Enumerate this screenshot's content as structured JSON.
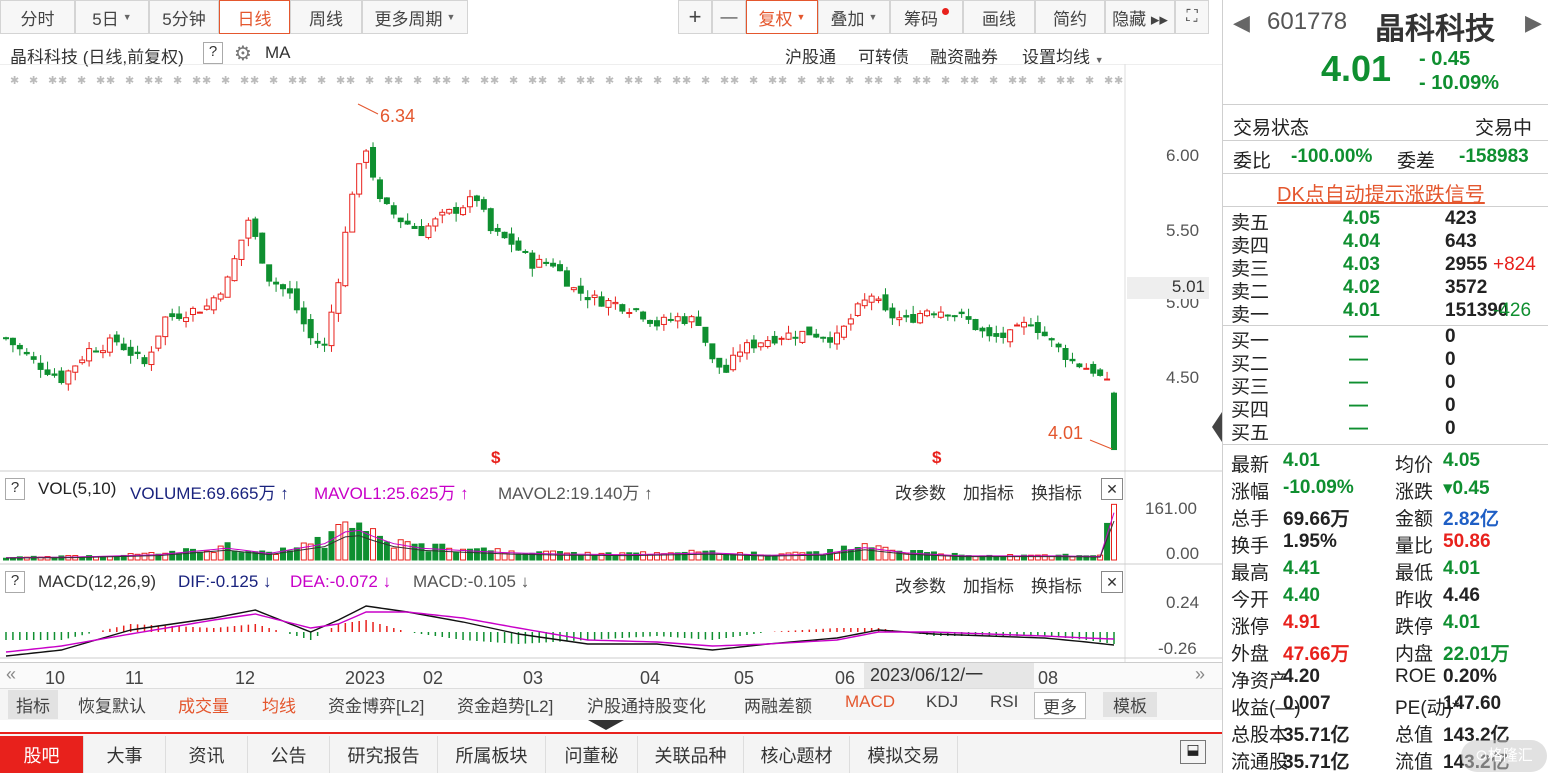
{
  "toolbar": {
    "tabs": [
      "分时",
      "5日",
      "5分钟",
      "日线",
      "周线",
      "更多周期"
    ],
    "right": [
      "+",
      "—",
      "复权",
      "叠加",
      "筹码",
      "画线",
      "简约",
      "隐藏 ▸▸"
    ]
  },
  "chart_header": {
    "title": "晶科科技 (日线,前复权)",
    "help": "?",
    "ma": "MA",
    "links": [
      "沪股通",
      "可转债",
      "融资融券",
      "设置均线"
    ]
  },
  "annotations": {
    "high": "6.34",
    "low": "4.01",
    "last_price_tag": "5.01",
    "s_marker": "$"
  },
  "vol_header": {
    "help": "?",
    "text1": "VOL(5,10)",
    "text2": "VOLUME:69.665万",
    "text3": "MAVOL1:25.625万",
    "text4": "MAVOL2:19.140万",
    "links": [
      "改参数",
      "加指标",
      "换指标"
    ],
    "close": "✕"
  },
  "macd_header": {
    "help": "?",
    "text1": "MACD(12,26,9)",
    "text2": "DIF:-0.125",
    "text3": "DEA:-0.072",
    "text4": "MACD:-0.105",
    "links": [
      "改参数",
      "加指标",
      "换指标"
    ],
    "close": "✕"
  },
  "cursor_date": "2023/06/12/一",
  "indicator_bar": [
    "指标",
    "恢复默认",
    "成交量",
    "均线",
    "资金博弈[L2]",
    "资金趋势[L2]",
    "沪股通持股变化",
    "两融差额",
    "MACD",
    "KDJ",
    "RSI",
    "更多",
    "模板"
  ],
  "bottom_tabs": [
    "股吧",
    "大事",
    "资讯",
    "公告",
    "研究报告",
    "所属板块",
    "问董秘",
    "关联品种",
    "核心题材",
    "模拟交易"
  ],
  "stock": {
    "code": "601778",
    "name": "晶科科技",
    "price": "4.01",
    "change": "- 0.45",
    "pct": "- 10.09%"
  },
  "status": {
    "label": "交易状态",
    "value": "交易中"
  },
  "weibi": {
    "label1": "委比",
    "v1": "-100.00%",
    "label2": "委差",
    "v2": "-158983"
  },
  "signal": "DK点自动提示涨跌信号",
  "asks": [
    {
      "label": "卖五",
      "price": "4.05",
      "vol": "423",
      "chg": ""
    },
    {
      "label": "卖四",
      "price": "4.04",
      "vol": "643",
      "chg": ""
    },
    {
      "label": "卖三",
      "price": "4.03",
      "vol": "2955",
      "chg": "+824"
    },
    {
      "label": "卖二",
      "price": "4.02",
      "vol": "3572",
      "chg": ""
    },
    {
      "label": "卖一",
      "price": "4.01",
      "vol": "151390",
      "chg": "-426"
    }
  ],
  "bids": [
    {
      "label": "买一",
      "price": "—",
      "vol": "0"
    },
    {
      "label": "买二",
      "price": "—",
      "vol": "0"
    },
    {
      "label": "买三",
      "price": "—",
      "vol": "0"
    },
    {
      "label": "买四",
      "price": "—",
      "vol": "0"
    },
    {
      "label": "买五",
      "price": "—",
      "vol": "0"
    }
  ],
  "stats": [
    {
      "l1": "最新",
      "v1": "4.01",
      "c1": "g",
      "l2": "均价",
      "v2": "4.05",
      "c2": "g"
    },
    {
      "l1": "涨幅",
      "v1": "-10.09%",
      "c1": "g",
      "l2": "涨跌",
      "v2": "▾0.45",
      "c2": "g"
    },
    {
      "l1": "总手",
      "v1": "69.66万",
      "c1": "",
      "l2": "金额",
      "v2": "2.82亿",
      "c2": "b"
    },
    {
      "l1": "换手",
      "v1": "1.95%",
      "c1": "",
      "l2": "量比",
      "v2": "50.86",
      "c2": "r"
    },
    {
      "l1": "最高",
      "v1": "4.41",
      "c1": "g",
      "l2": "最低",
      "v2": "4.01",
      "c2": "g"
    },
    {
      "l1": "今开",
      "v1": "4.40",
      "c1": "g",
      "l2": "昨收",
      "v2": "4.46",
      "c2": ""
    },
    {
      "l1": "涨停",
      "v1": "4.91",
      "c1": "r",
      "l2": "跌停",
      "v2": "4.01",
      "c2": "g"
    },
    {
      "l1": "外盘",
      "v1": "47.66万",
      "c1": "r",
      "l2": "内盘",
      "v2": "22.01万",
      "c2": "g"
    },
    {
      "l1": "净资产",
      "v1": "4.20",
      "c1": "",
      "l2": "ROE",
      "v2": "0.20%",
      "c2": ""
    },
    {
      "l1": "收益(—)",
      "v1": "0.007",
      "c1": "",
      "l2": "PE(动)*",
      "v2": "147.60",
      "c2": ""
    },
    {
      "l1": "总股本",
      "v1": "35.71亿",
      "c1": "",
      "l2": "总值",
      "v2": "143.2亿",
      "c2": ""
    },
    {
      "l1": "流通股",
      "v1": "35.71亿",
      "c1": "",
      "l2": "流值",
      "v2": "143.2亿",
      "c2": ""
    }
  ],
  "colors": {
    "up": "#e8211c",
    "down": "#0f8f30",
    "accent": "#e4572e",
    "ma": "#c800c8"
  },
  "chart_data": {
    "type": "candlestick",
    "price_axis": {
      "ticks": [
        "6.00",
        "5.50",
        "5.00",
        "4.50"
      ],
      "range": [
        4.0,
        6.4
      ]
    },
    "volume_axis": {
      "ticks": [
        "161.00",
        "0.00"
      ]
    },
    "macd_axis": {
      "ticks": [
        "0.24",
        "-0.26"
      ]
    },
    "x_labels": [
      "10",
      "11",
      "12",
      "2023",
      "02",
      "03",
      "04",
      "05",
      "06",
      "08"
    ],
    "close_path": [
      [
        0,
        4.78
      ],
      [
        4,
        4.62
      ],
      [
        8,
        4.5
      ],
      [
        12,
        4.7
      ],
      [
        16,
        4.76
      ],
      [
        20,
        4.6
      ],
      [
        23,
        4.92
      ],
      [
        26,
        4.96
      ],
      [
        29,
        5.0
      ],
      [
        32,
        5.18
      ],
      [
        35,
        5.6
      ],
      [
        38,
        5.2
      ],
      [
        41,
        5.08
      ],
      [
        44,
        4.78
      ],
      [
        46,
        4.72
      ],
      [
        48,
        5.2
      ],
      [
        50,
        5.8
      ],
      [
        52,
        6.1
      ],
      [
        54,
        5.72
      ],
      [
        57,
        5.6
      ],
      [
        60,
        5.52
      ],
      [
        63,
        5.62
      ],
      [
        66,
        5.7
      ],
      [
        68,
        5.75
      ],
      [
        70,
        5.52
      ],
      [
        73,
        5.44
      ],
      [
        76,
        5.3
      ],
      [
        79,
        5.3
      ],
      [
        82,
        5.12
      ],
      [
        85,
        5.05
      ],
      [
        88,
        5.02
      ],
      [
        91,
        4.98
      ],
      [
        94,
        4.88
      ],
      [
        97,
        4.92
      ],
      [
        100,
        4.9
      ],
      [
        102,
        4.62
      ],
      [
        104,
        4.55
      ],
      [
        106,
        4.7
      ],
      [
        109,
        4.76
      ],
      [
        112,
        4.8
      ],
      [
        116,
        4.82
      ],
      [
        120,
        4.78
      ],
      [
        123,
        4.98
      ],
      [
        125,
        5.08
      ],
      [
        127,
        4.95
      ],
      [
        130,
        4.9
      ],
      [
        133,
        4.98
      ],
      [
        136,
        4.97
      ],
      [
        139,
        4.9
      ],
      [
        142,
        4.78
      ],
      [
        145,
        4.8
      ],
      [
        148,
        4.9
      ],
      [
        151,
        4.75
      ],
      [
        154,
        4.62
      ],
      [
        157,
        4.56
      ],
      [
        159,
        4.46
      ],
      [
        160,
        4.01
      ]
    ],
    "volume_spikes": [
      [
        0,
        8
      ],
      [
        10,
        10
      ],
      [
        22,
        18
      ],
      [
        32,
        40
      ],
      [
        38,
        22
      ],
      [
        46,
        55
      ],
      [
        49,
        95
      ],
      [
        51,
        100
      ],
      [
        53,
        80
      ],
      [
        56,
        55
      ],
      [
        60,
        40
      ],
      [
        66,
        32
      ],
      [
        72,
        25
      ],
      [
        80,
        20
      ],
      [
        90,
        18
      ],
      [
        102,
        24
      ],
      [
        110,
        16
      ],
      [
        118,
        20
      ],
      [
        124,
        42
      ],
      [
        130,
        24
      ],
      [
        138,
        14
      ],
      [
        145,
        14
      ],
      [
        152,
        14
      ],
      [
        158,
        12
      ],
      [
        160,
        160
      ]
    ],
    "macd_dif": [
      [
        0,
        -0.24
      ],
      [
        8,
        -0.18
      ],
      [
        18,
        0.02
      ],
      [
        30,
        0.14
      ],
      [
        36,
        0.22
      ],
      [
        44,
        0.0
      ],
      [
        48,
        0.12
      ],
      [
        52,
        0.26
      ],
      [
        58,
        0.2
      ],
      [
        66,
        0.1
      ],
      [
        74,
        -0.02
      ],
      [
        84,
        -0.12
      ],
      [
        94,
        -0.12
      ],
      [
        102,
        -0.18
      ],
      [
        110,
        -0.12
      ],
      [
        120,
        -0.06
      ],
      [
        126,
        0.02
      ],
      [
        134,
        -0.02
      ],
      [
        142,
        -0.04
      ],
      [
        150,
        -0.06
      ],
      [
        156,
        -0.1
      ],
      [
        160,
        -0.13
      ]
    ],
    "macd_dea": [
      [
        0,
        -0.2
      ],
      [
        8,
        -0.14
      ],
      [
        18,
        -0.02
      ],
      [
        30,
        0.12
      ],
      [
        36,
        0.18
      ],
      [
        44,
        0.04
      ],
      [
        48,
        0.08
      ],
      [
        52,
        0.2
      ],
      [
        58,
        0.2
      ],
      [
        66,
        0.14
      ],
      [
        74,
        0.04
      ],
      [
        84,
        -0.08
      ],
      [
        94,
        -0.1
      ],
      [
        102,
        -0.14
      ],
      [
        110,
        -0.12
      ],
      [
        120,
        -0.08
      ],
      [
        126,
        0.0
      ],
      [
        134,
        0.0
      ],
      [
        142,
        -0.02
      ],
      [
        150,
        -0.04
      ],
      [
        156,
        -0.06
      ],
      [
        160,
        -0.07
      ]
    ]
  }
}
